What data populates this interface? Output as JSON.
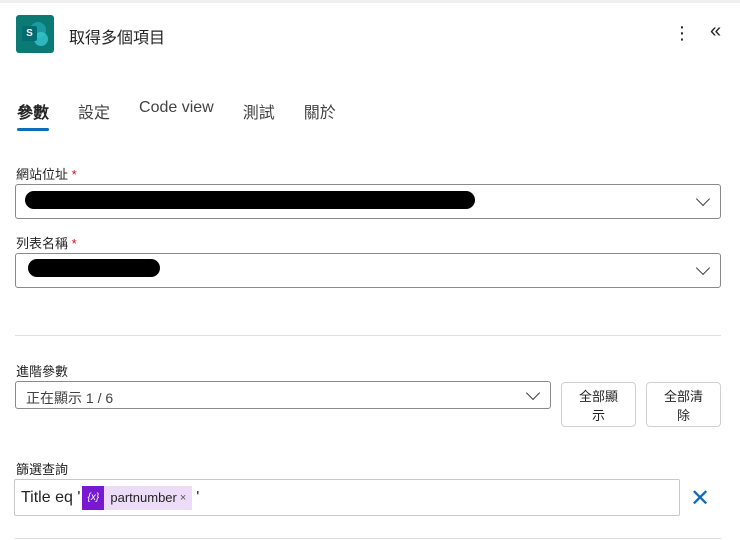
{
  "header": {
    "title": "取得多個項目",
    "logo_letter": "S",
    "more_icon": "more-vertical-icon",
    "collapse_icon": "double-chevron-left-icon"
  },
  "tabs": [
    {
      "label": "參數",
      "active": true
    },
    {
      "label": "設定"
    },
    {
      "label": "Code view"
    },
    {
      "label": "測試"
    },
    {
      "label": "關於"
    }
  ],
  "fields": {
    "site_address": {
      "label": "網站位址",
      "required": "*"
    },
    "list_name": {
      "label": "列表名稱",
      "required": "*"
    },
    "advanced": {
      "label": "進階參數",
      "value": "正在顯示 1 / 6",
      "show_all": "全部顯示",
      "clear_all": "全部清除"
    },
    "filter": {
      "label": "篩選查詢",
      "prefix": "Title eq '",
      "token": "partnumber",
      "token_icon": "{x}",
      "token_remove": "×",
      "suffix": "'",
      "clear": "✕"
    }
  },
  "colors": {
    "accent": "#0f6cbd",
    "token_bg": "#ecdcf7",
    "token_icon": "#7719d1",
    "sharepoint": "#0b7a75"
  }
}
